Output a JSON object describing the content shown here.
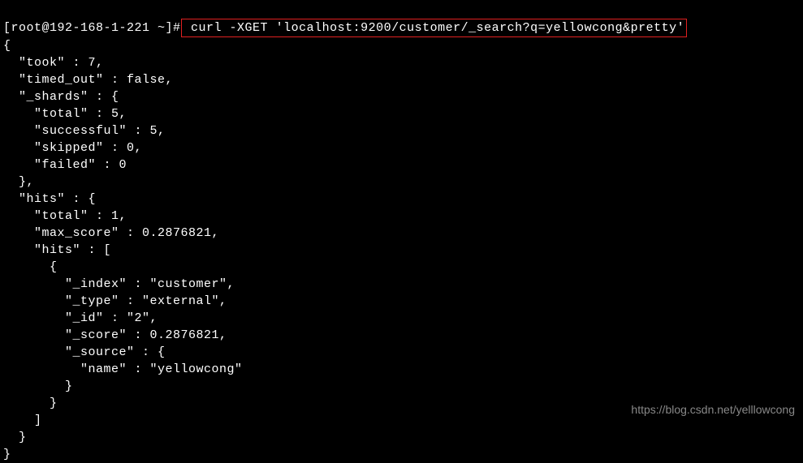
{
  "prompt": {
    "user_host": "[root@192-168-1-221 ~]#",
    "command": " curl -XGET 'localhost:9200/customer/_search?q=yellowcong&pretty'"
  },
  "output": {
    "line01": "{",
    "line02": "  \"took\" : 7,",
    "line03": "  \"timed_out\" : false,",
    "line04": "  \"_shards\" : {",
    "line05": "    \"total\" : 5,",
    "line06": "    \"successful\" : 5,",
    "line07": "    \"skipped\" : 0,",
    "line08": "    \"failed\" : 0",
    "line09": "  },",
    "line10": "  \"hits\" : {",
    "line11": "    \"total\" : 1,",
    "line12": "    \"max_score\" : 0.2876821,",
    "line13": "    \"hits\" : [",
    "line14": "      {",
    "line15": "        \"_index\" : \"customer\",",
    "line16": "        \"_type\" : \"external\",",
    "line17": "        \"_id\" : \"2\",",
    "line18": "        \"_score\" : 0.2876821,",
    "line19": "        \"_source\" : {",
    "line20": "          \"name\" : \"yellowcong\"",
    "line21": "        }",
    "line22": "      }",
    "line23": "    ]",
    "line24": "  }",
    "line25": "}"
  },
  "watermark": "https://blog.csdn.net/yelllowcong"
}
